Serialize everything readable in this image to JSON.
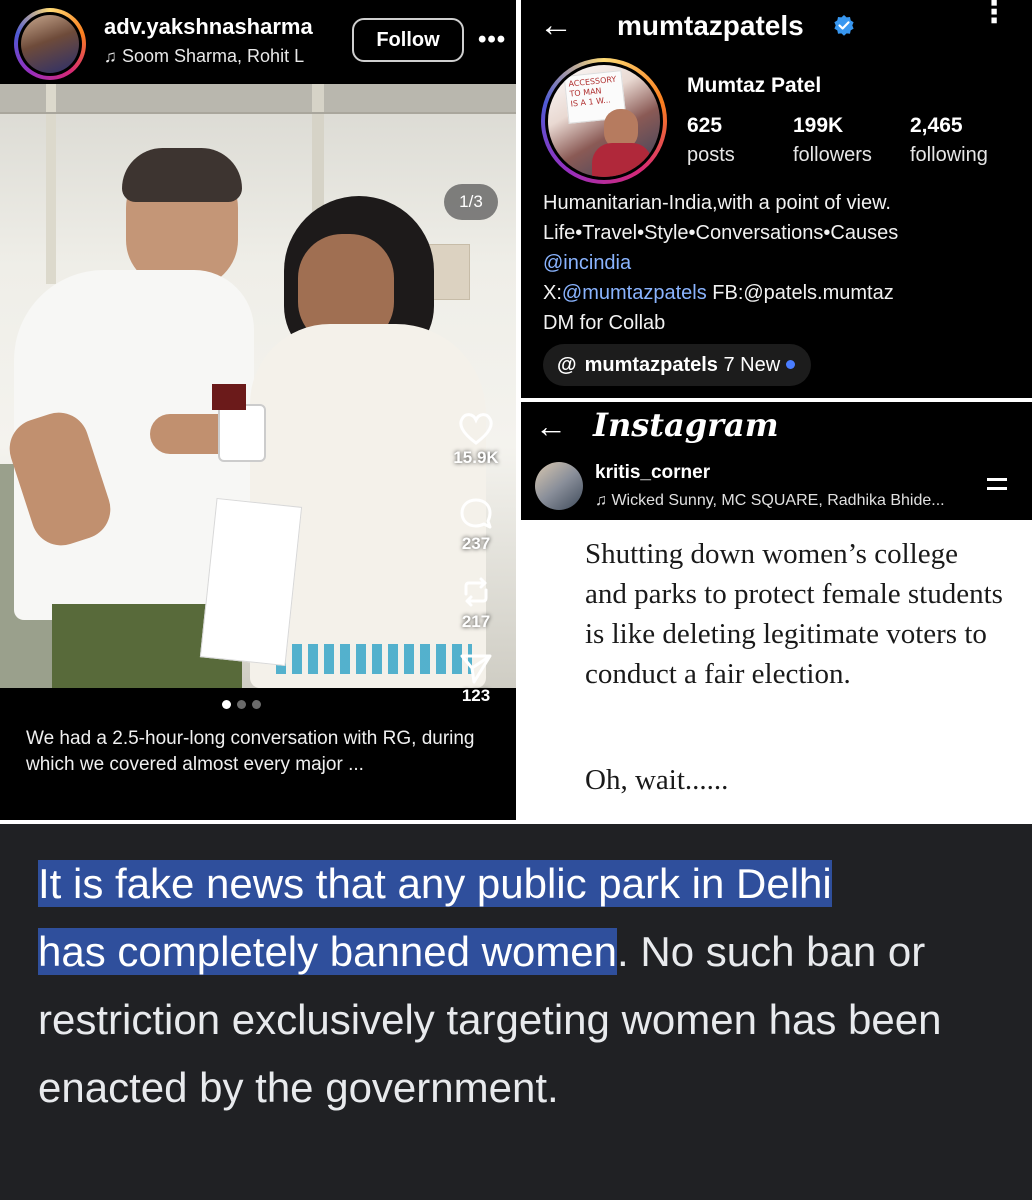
{
  "reel": {
    "username": "adv.yakshnasharma",
    "music": "Soom Sharma, Rohit L",
    "follow_label": "Follow",
    "more_label": "•••",
    "page_indicator": "1/3",
    "likes": "15.9K",
    "comments": "237",
    "reposts": "217",
    "shares": "123",
    "carousel_count": 3,
    "carousel_active": 1,
    "caption": "We had a 2.5-hour-long conversation with RG, during which we covered almost every major ..."
  },
  "profile": {
    "back_label": "←",
    "handle": "mumtazpatels",
    "name": "Mumtaz Patel",
    "posts": "625",
    "posts_label": "posts",
    "followers": "199K",
    "followers_label": "followers",
    "following": "2,465",
    "following_label": "following",
    "bio_line1": "Humanitarian-India,with a point of view.",
    "bio_line2": "Life•Travel•Style•Conversations•Causes",
    "bio_link": "@incindia",
    "bio_x_prefix": "X:",
    "bio_x_link": "@mumtazpatels",
    "bio_fb": " FB:@patels.mumtaz",
    "bio_line5": "DM for Collab",
    "threads_handle": "mumtazpatels",
    "threads_new": "7 New",
    "avatar_sign_lines": [
      "ACCESSORY",
      "TO MAN",
      "IS A 1 W..."
    ]
  },
  "post": {
    "back_label": "←",
    "logo": "Instagram",
    "username": "kritis_corner",
    "music": "Wicked Sunny, MC SQUARE, Radhika Bhide...",
    "quote": "Shutting down women’s college and parks to protect female students is like deleting legitimate voters to conduct a fair election.",
    "quote_tail": "Oh, wait......"
  },
  "answer": {
    "highlighted_1": "It is fake news that any public park in Delhi",
    "highlighted_2": "has completely banned women",
    "rest": ". No such ban or restriction exclusively targeting women has been enacted by the government."
  },
  "colors": {
    "highlight": "#2f4f9c",
    "link": "#8ab4ff",
    "verified": "#3897f0",
    "new_dot": "#4a7dff",
    "answer_bg": "#202124"
  }
}
